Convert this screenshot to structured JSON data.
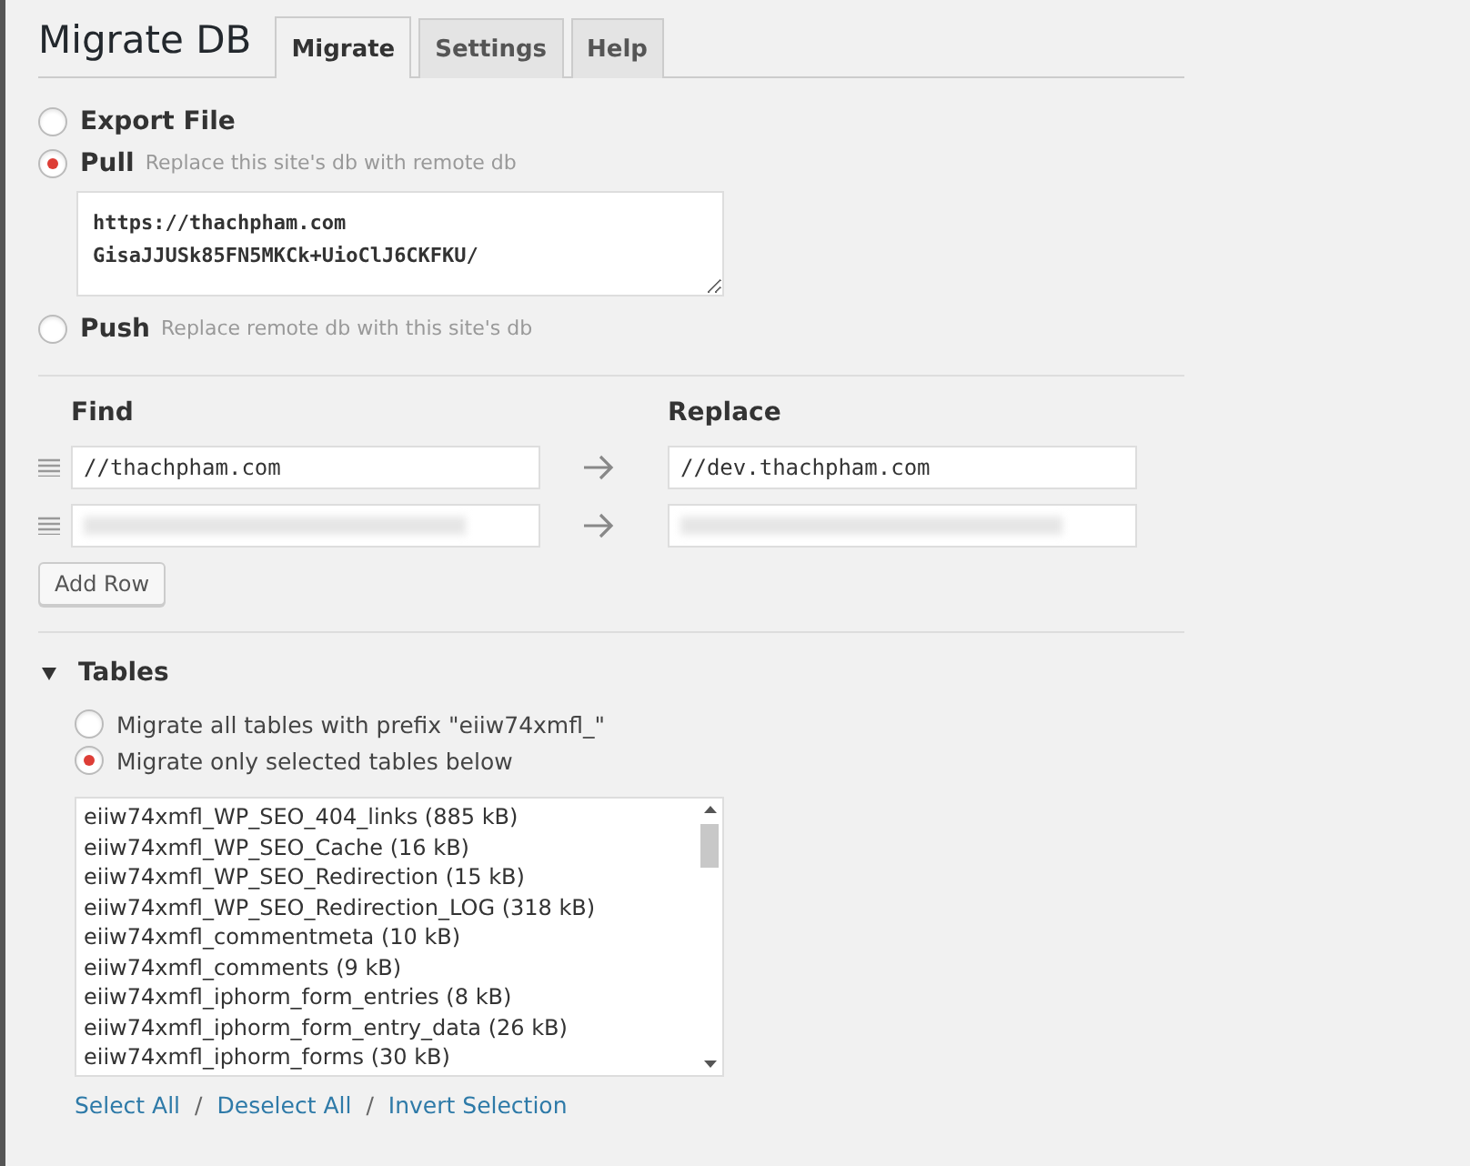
{
  "title": "Migrate DB",
  "tabs": [
    {
      "label": "Migrate",
      "selected": true
    },
    {
      "label": "Settings",
      "selected": false
    },
    {
      "label": "Help",
      "selected": false
    }
  ],
  "actions": [
    {
      "label": "Export File",
      "selected": false
    },
    {
      "label": "Pull",
      "description": "Replace this site's db with remote db",
      "selected": true,
      "connection": "https://thachpham.com\nGisaJJUSk85FN5MKCk+UioClJ6CKFKU/"
    },
    {
      "label": "Push",
      "description": "Replace remote db with this site's db",
      "selected": false
    }
  ],
  "find_replace": {
    "find_heading": "Find",
    "replace_heading": "Replace",
    "rows": [
      {
        "find": "//thachpham.com",
        "replace": "//dev.thachpham.com",
        "blurred": false
      },
      {
        "find": "",
        "replace": "",
        "blurred": true
      }
    ],
    "add_row": "Add Row"
  },
  "tables": {
    "heading": "Tables",
    "expanded": true,
    "options": [
      {
        "label": "Migrate all tables with prefix \"eiiw74xmfl_\"",
        "selected": false
      },
      {
        "label": "Migrate only selected tables below",
        "selected": true
      }
    ],
    "items": [
      "eiiw74xmfl_WP_SEO_404_links (885 kB)",
      "eiiw74xmfl_WP_SEO_Cache (16 kB)",
      "eiiw74xmfl_WP_SEO_Redirection (15 kB)",
      "eiiw74xmfl_WP_SEO_Redirection_LOG (318 kB)",
      "eiiw74xmfl_commentmeta (10 kB)",
      "eiiw74xmfl_comments (9 kB)",
      "eiiw74xmfl_iphorm_form_entries (8 kB)",
      "eiiw74xmfl_iphorm_form_entry_data (26 kB)",
      "eiiw74xmfl_iphorm_forms (30 kB)"
    ],
    "links": [
      "Select All",
      "Deselect All",
      "Invert Selection"
    ],
    "separator": "/"
  }
}
